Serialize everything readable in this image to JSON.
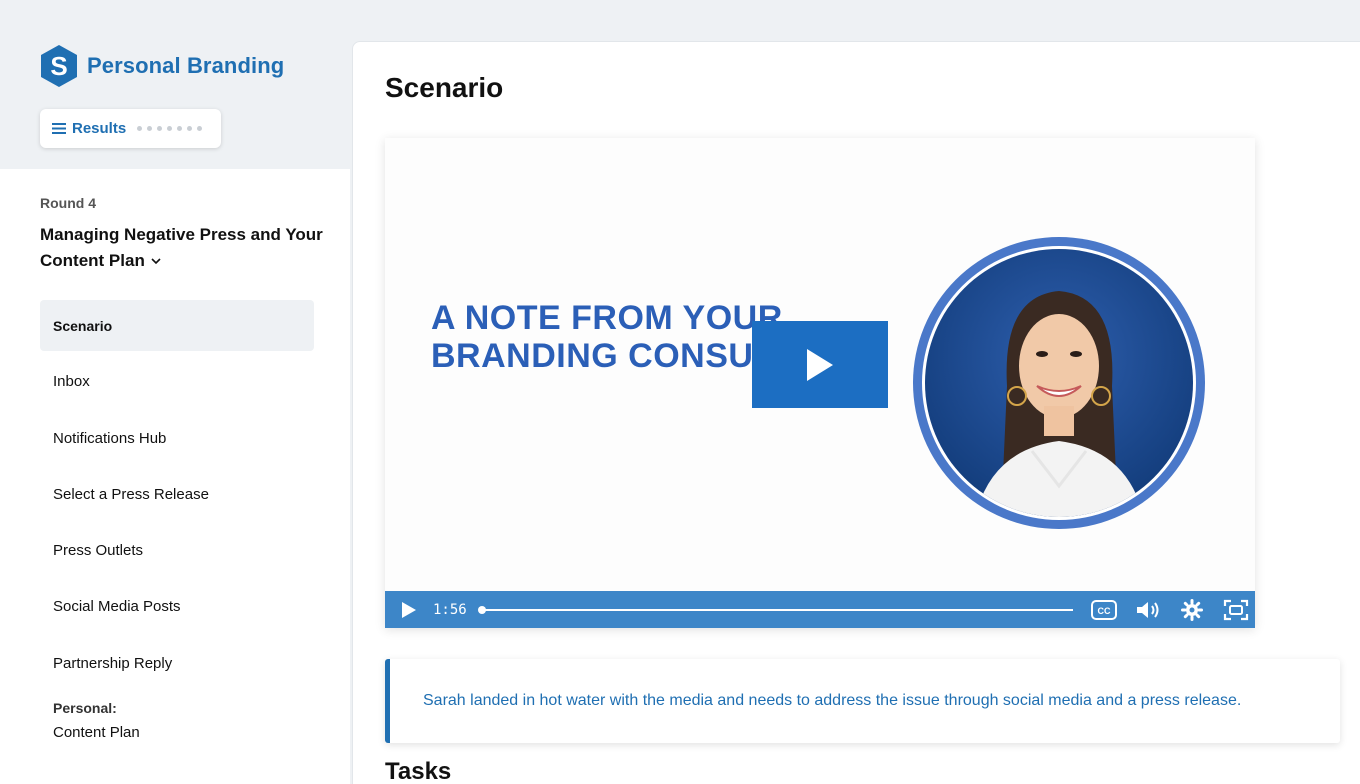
{
  "brand": {
    "name": "Personal Branding",
    "logo_letter": "S"
  },
  "results_button": {
    "label": "Results"
  },
  "round": {
    "label": "Round 4",
    "title": "Managing Negative Press and Your Content Plan"
  },
  "nav": {
    "items": [
      {
        "label": "Scenario",
        "active": true
      },
      {
        "label": "Inbox"
      },
      {
        "label": "Notifications Hub"
      },
      {
        "label": "Select a Press Release"
      },
      {
        "label": "Press Outlets"
      },
      {
        "label": "Social Media Posts"
      },
      {
        "label": "Partnership Reply"
      }
    ],
    "group": {
      "label": "Personal:",
      "item": "Content Plan"
    }
  },
  "main": {
    "title": "Scenario",
    "video": {
      "headline_line1": "A NOTE FROM YOUR",
      "headline_line2": "BRANDING CONSULTANT",
      "time": "1:56"
    },
    "callout": "Sarah landed in hot water with the media and needs to address the issue through social media and a press release.",
    "tasks_title": "Tasks"
  },
  "colors": {
    "brand_blue": "#1f6fb2",
    "play_blue": "#1c6ec2",
    "controls_blue": "#3d86c8",
    "headline_blue": "#2b5fb7"
  },
  "icons": [
    "shield-s-logo-icon",
    "menu-icon",
    "chevron-down-icon",
    "play-icon",
    "closed-captions-icon",
    "volume-icon",
    "settings-gear-icon",
    "fullscreen-icon"
  ]
}
